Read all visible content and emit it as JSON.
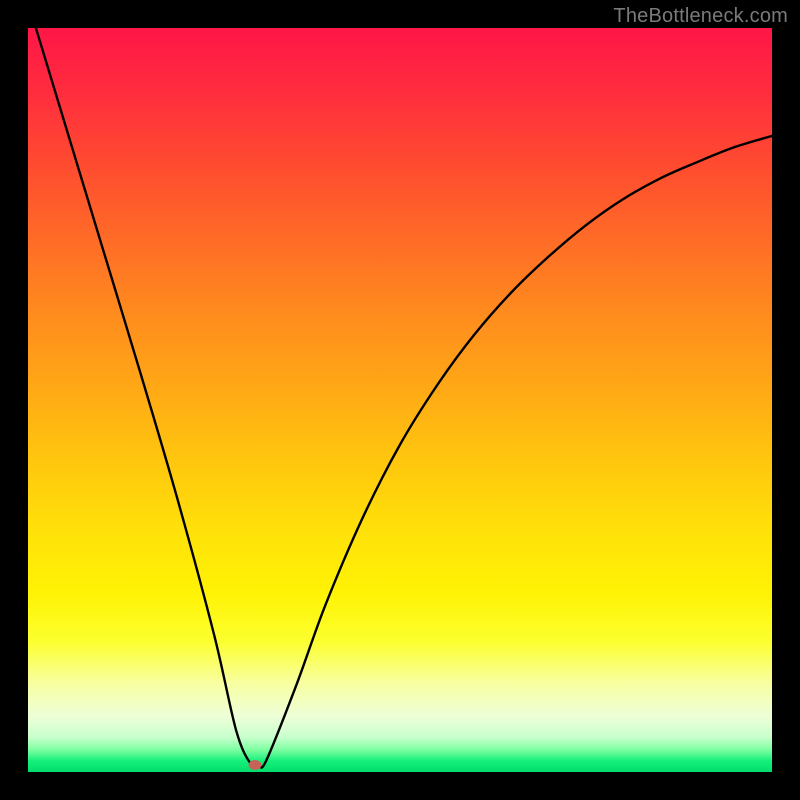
{
  "watermark": "TheBottleneck.com",
  "chart_data": {
    "type": "line",
    "title": "",
    "xlabel": "",
    "ylabel": "",
    "xlim": [
      0,
      1
    ],
    "ylim": [
      0,
      1
    ],
    "series": [
      {
        "name": "bottleneck-curve",
        "x": [
          0.0,
          0.05,
          0.1,
          0.15,
          0.2,
          0.25,
          0.28,
          0.3,
          0.31,
          0.32,
          0.36,
          0.4,
          0.45,
          0.5,
          0.55,
          0.6,
          0.65,
          0.7,
          0.75,
          0.8,
          0.85,
          0.9,
          0.95,
          1.0
        ],
        "values": [
          1.035,
          0.87,
          0.705,
          0.54,
          0.37,
          0.185,
          0.055,
          0.01,
          0.01,
          0.015,
          0.115,
          0.225,
          0.342,
          0.44,
          0.52,
          0.588,
          0.645,
          0.693,
          0.735,
          0.77,
          0.798,
          0.82,
          0.84,
          0.855
        ]
      }
    ],
    "annotations": [
      {
        "name": "min-marker",
        "x": 0.305,
        "y": 0.01
      }
    ]
  },
  "colors": {
    "marker": "#c56358",
    "curve": "#000000",
    "watermark": "#7a7a7a"
  }
}
